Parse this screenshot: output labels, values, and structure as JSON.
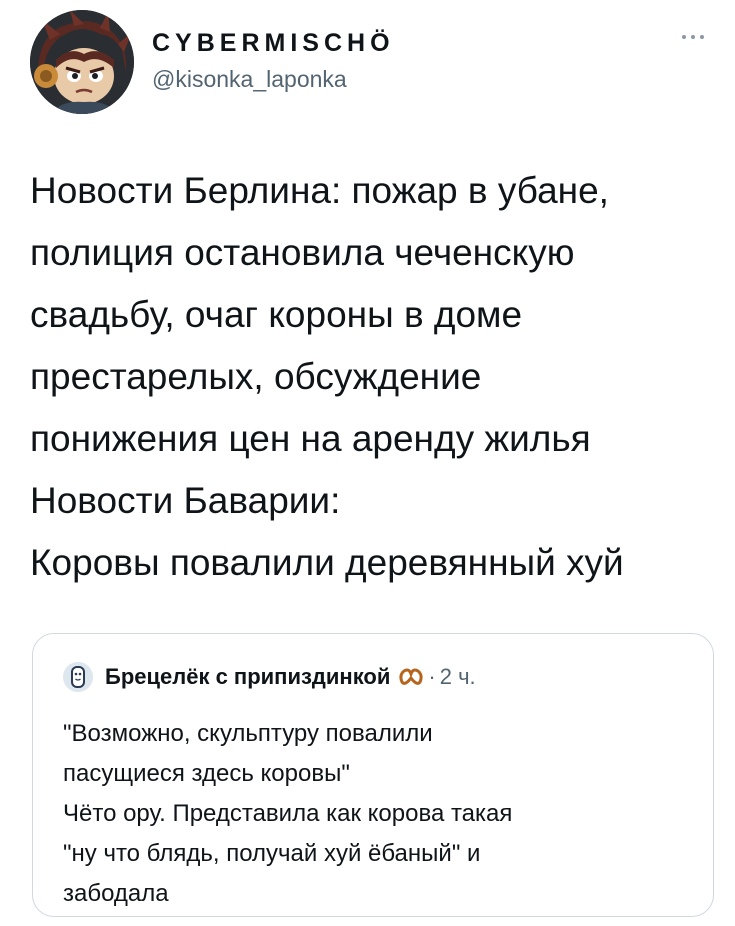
{
  "author": {
    "display_name": "CYBERMISCHÖ",
    "handle": "@kisonka_laponka"
  },
  "tweet": {
    "lines": [
      "Новости Берлина: пожар в убане,",
      "полиция остановила чеченскую",
      "свадьбу, очаг короны в доме",
      "престарелых, обсуждение",
      "понижения цен на аренду жилья",
      "Новости Баварии:",
      "Коровы повалили деревянный хуй"
    ]
  },
  "quoted_tweet": {
    "author_name": "Брецелёк с припиздинкой",
    "separator": "·",
    "time": "2 ч.",
    "lines": [
      "\"Возможно, скульптуру повалили",
      "пасущиеся здесь коровы\"",
      "Чёто ору. Представила как корова такая",
      "\"ну что блядь, получай хуй ёбаный\" и",
      "забодала"
    ]
  },
  "icons": {
    "more": "more-horizontal-icon",
    "pretzel": "pretzel-emoji-icon"
  },
  "colors": {
    "text_primary": "#0f1419",
    "text_secondary": "#536471",
    "border": "#cfd9de"
  }
}
